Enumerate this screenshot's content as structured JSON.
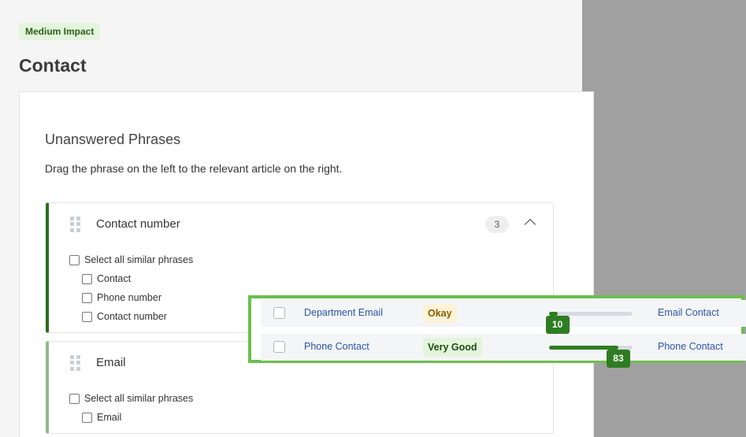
{
  "header": {
    "impact_badge": "Medium Impact",
    "title": "Contact"
  },
  "section": {
    "title": "Unanswered Phrases",
    "description": "Drag the phrase on the left to the relevant article on the right."
  },
  "groups": [
    {
      "name": "Contact number",
      "count": "3",
      "select_all_label": "Select all similar phrases",
      "phrases": [
        "Contact",
        "Phone number",
        "Contact number"
      ]
    },
    {
      "name": "Email",
      "select_all_label": "Select all similar phrases",
      "phrases": [
        "Email"
      ]
    }
  ],
  "drag_preview": {
    "rows": [
      {
        "title": "Department Email",
        "rating": "Okay",
        "score": "10",
        "score_fraction": 0.1,
        "article": "Email Contact"
      },
      {
        "title": "Phone Contact",
        "rating": "Very Good",
        "score": "83",
        "score_fraction": 0.83,
        "article": "Phone Contact"
      }
    ]
  },
  "colors": {
    "accent_green": "#2e7d22",
    "highlight_border": "#6abf4b",
    "link_blue": "#2a55a6",
    "overlay_gray": "#a0a0a0"
  }
}
